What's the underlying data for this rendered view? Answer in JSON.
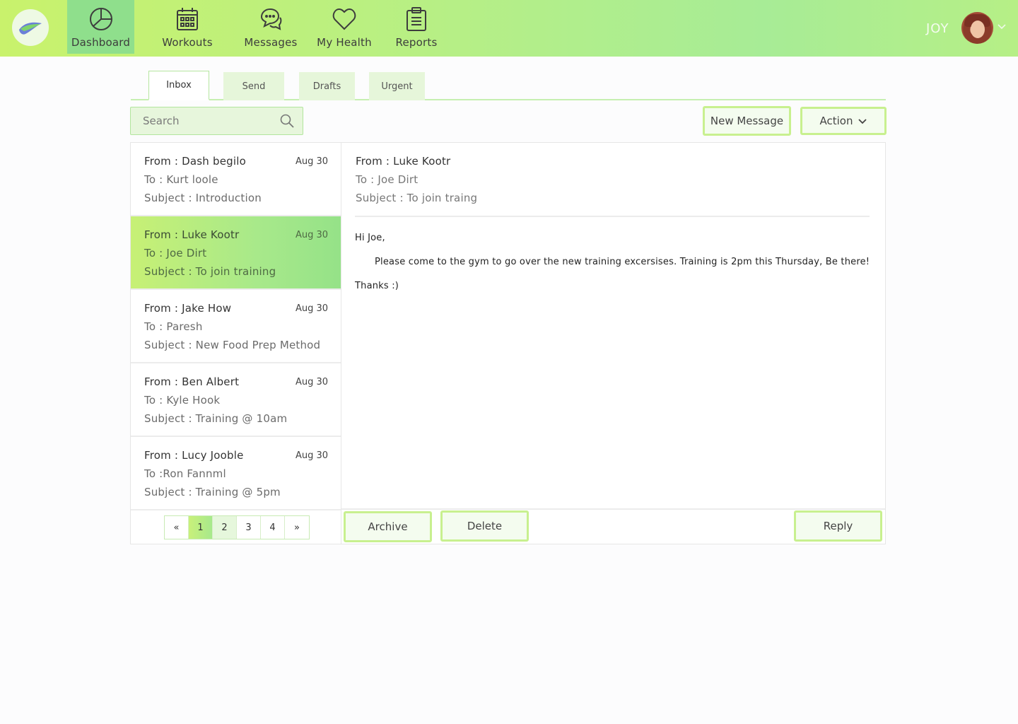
{
  "nav": {
    "items": [
      {
        "label": "Dashboard",
        "icon": "pie-chart-icon"
      },
      {
        "label": "Workouts",
        "icon": "calendar-icon"
      },
      {
        "label": "Messages",
        "icon": "chat-bubbles-icon"
      },
      {
        "label": "My Health",
        "icon": "heart-icon"
      },
      {
        "label": "Reports",
        "icon": "clipboard-icon"
      }
    ],
    "active": "Dashboard",
    "user_name": "JOY"
  },
  "tabs": [
    {
      "label": "Inbox"
    },
    {
      "label": "Send"
    },
    {
      "label": "Drafts"
    },
    {
      "label": "Urgent"
    }
  ],
  "active_tab": "Inbox",
  "search": {
    "placeholder": "Search"
  },
  "toolbar": {
    "new_message": "New Message",
    "action": "Action"
  },
  "messages": [
    {
      "from": "From  :  Dash begilo",
      "to": "To  :  Kurt loole",
      "subject": "Subject  :  Introduction",
      "date": "Aug 30"
    },
    {
      "from": "From  :  Luke Kootr",
      "to": "To  :  Joe Dirt",
      "subject": "Subject  :  To join training",
      "date": "Aug 30"
    },
    {
      "from": "From  :  Jake How",
      "to": "To  :  Paresh",
      "subject": "Subject  :  New Food Prep Method",
      "date": "Aug 30"
    },
    {
      "from": "From  :  Ben Albert",
      "to": "To  :  Kyle Hook",
      "subject": "Subject  :  Training  @  10am",
      "date": "Aug 30"
    },
    {
      "from": "From  :  Lucy Jooble",
      "to": "To  :Ron Fannml",
      "subject": "Subject  :  Training  @  5pm",
      "date": "Aug 30"
    }
  ],
  "pagination": [
    "«",
    "1",
    "2",
    "3",
    "4",
    "»"
  ],
  "detail": {
    "from": "From  :  Luke Kootr",
    "to": "To  :  Joe Dirt",
    "subject": "Subject  :  To join traing",
    "greeting": "Hi Joe,",
    "body": "Please come to the gym to go over the new training excersises. Training is 2pm this Thursday, Be there!",
    "signoff": "Thanks :)"
  },
  "actions": {
    "archive": "Archive",
    "delete": "Delete",
    "reply": "Reply"
  },
  "colors": {
    "accent": "#c8f08f",
    "selected": "#a8e98a",
    "nav_active": "#8fdf8c"
  }
}
